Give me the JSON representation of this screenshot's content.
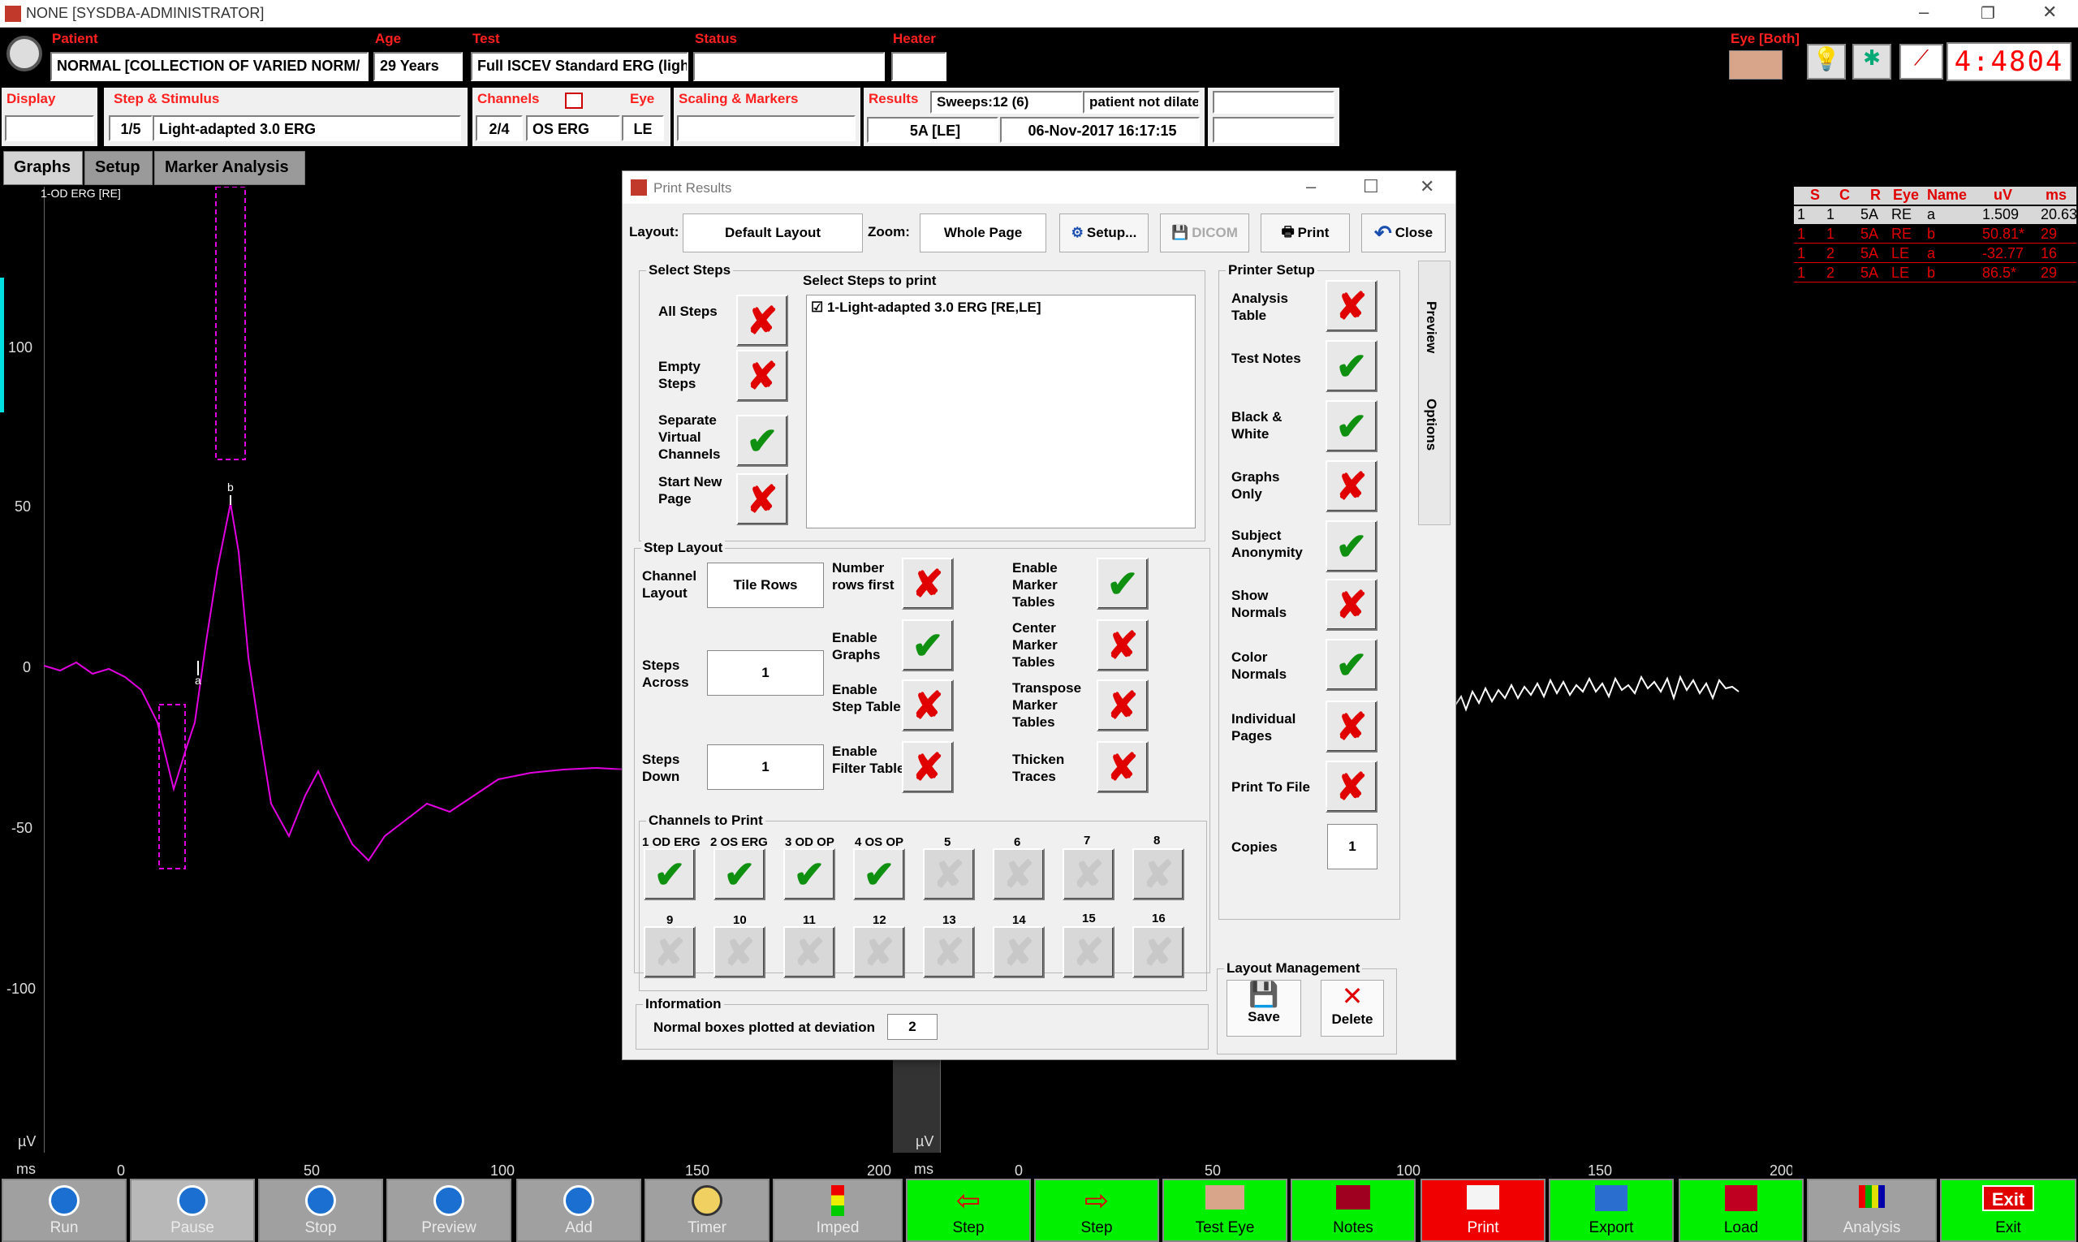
{
  "window": {
    "title": "NONE [SYSDBA-ADMINISTRATOR]"
  },
  "header": {
    "patient_label": "Patient",
    "patient_value": "NORMAL [COLLECTION OF VARIED NORM/",
    "age_label": "Age",
    "age_value": "29 Years",
    "test_label": "Test",
    "test_value": "Full ISCEV Standard ERG (ligh",
    "status_label": "Status",
    "heater_label": "Heater",
    "eye_label": "Eye [Both]",
    "timer": "4:4804",
    "display_label": "Display",
    "step_label": "Step & Stimulus",
    "step_num": "1/5",
    "step_value": "Light-adapted 3.0 ERG",
    "channels_label": "Channels",
    "channel_num": "2/4",
    "channel_value": "OS ERG",
    "eye_col_label": "Eye",
    "eye_value": "LE",
    "scaling_label": "Scaling & Markers",
    "results_label": "Results",
    "sweeps": "Sweeps:12 (6)",
    "results_note": "patient not dilate",
    "result_code": "5A [LE]",
    "result_date": "06-Nov-2017 16:17:15"
  },
  "tabs": [
    "Graphs",
    "Setup",
    "Marker Analysis"
  ],
  "graph_left": {
    "channel_label": "1-OD ERG [RE]",
    "y_ticks": [
      "100",
      "50",
      "0",
      "-50",
      "-100"
    ],
    "x_ticks": [
      "0",
      "50",
      "100",
      "150",
      "200"
    ],
    "unit_y": "µV",
    "unit_x": "ms",
    "marker_a": "a",
    "marker_b": "b"
  },
  "graph_right": {
    "x_ticks": [
      "0",
      "50",
      "100",
      "150",
      "200"
    ],
    "unit_y": "µV",
    "unit_x": "ms"
  },
  "results_table": {
    "headers": [
      "S",
      "C",
      "R",
      "Eye",
      "Name",
      "uV",
      "ms"
    ],
    "rows": [
      [
        "1",
        "1",
        "5A",
        "RE",
        "a",
        "1.509",
        "20.63"
      ],
      [
        "1",
        "1",
        "5A",
        "RE",
        "b",
        "50.81*",
        "29"
      ],
      [
        "1",
        "2",
        "5A",
        "LE",
        "a",
        "-32.77",
        "16"
      ],
      [
        "1",
        "2",
        "5A",
        "LE",
        "b",
        "86.5*",
        "29"
      ]
    ]
  },
  "toolbar": [
    "Run",
    "Pause",
    "Stop",
    "Preview",
    "Add",
    "Timer",
    "Imped",
    "Step",
    "Step",
    "Test Eye",
    "Notes",
    "Print",
    "Export",
    "Load",
    "Analysis",
    "Exit"
  ],
  "exit_badge": "Exit",
  "dialog": {
    "title": "Print Results",
    "layout_label": "Layout:",
    "layout_value": "Default Layout",
    "zoom_label": "Zoom:",
    "zoom_value": "Whole Page",
    "setup_btn": "Setup...",
    "dicom_btn": "DICOM",
    "print_btn": "Print",
    "close_btn": "Close",
    "side_tabs": [
      "Preview",
      "Options"
    ],
    "select_steps_title": "Select Steps",
    "select_steps": [
      {
        "label": "All Steps",
        "state": "x"
      },
      {
        "label": "Empty Steps",
        "state": "x"
      },
      {
        "label": "Separate Virtual Channels",
        "state": "ok"
      },
      {
        "label": "Start New Page",
        "state": "x"
      }
    ],
    "steps_to_print_title": "Select Steps to print",
    "steps_to_print": [
      "1-Light-adapted 3.0 ERG [RE,LE]"
    ],
    "step_layout_title": "Step Layout",
    "channel_layout_label": "Channel Layout",
    "channel_layout_value": "Tile Rows",
    "steps_across_label": "Steps Across",
    "steps_across_value": "1",
    "steps_down_label": "Steps Down",
    "steps_down_value": "1",
    "layout_opts_a": [
      {
        "label": "Number rows first",
        "state": "x"
      },
      {
        "label": "Enable Graphs",
        "state": "ok"
      },
      {
        "label": "Enable Step Table",
        "state": "x"
      },
      {
        "label": "Enable Filter Table",
        "state": "x"
      }
    ],
    "layout_opts_b": [
      {
        "label": "Enable Marker Tables",
        "state": "ok"
      },
      {
        "label": "Center Marker Tables",
        "state": "x"
      },
      {
        "label": "Transpose Marker Tables",
        "state": "x"
      },
      {
        "label": "Thicken Traces",
        "state": "x"
      }
    ],
    "channels_title": "Channels to Print",
    "channels": [
      {
        "label": "1 OD ERG",
        "state": "ok"
      },
      {
        "label": "2 OS ERG",
        "state": "ok"
      },
      {
        "label": "3 OD OP",
        "state": "ok"
      },
      {
        "label": "4 OS OP",
        "state": "ok"
      },
      {
        "label": "5",
        "state": "dis"
      },
      {
        "label": "6",
        "state": "dis"
      },
      {
        "label": "7",
        "state": "dis"
      },
      {
        "label": "8",
        "state": "dis"
      },
      {
        "label": "9",
        "state": "dis"
      },
      {
        "label": "10",
        "state": "dis"
      },
      {
        "label": "11",
        "state": "dis"
      },
      {
        "label": "12",
        "state": "dis"
      },
      {
        "label": "13",
        "state": "dis"
      },
      {
        "label": "14",
        "state": "dis"
      },
      {
        "label": "15",
        "state": "dis"
      },
      {
        "label": "16",
        "state": "dis"
      }
    ],
    "info_title": "Information",
    "info_label": "Normal boxes plotted at deviation",
    "info_value": "2",
    "printer_setup_title": "Printer Setup",
    "printer_opts": [
      {
        "label": "Analysis Table",
        "state": "x"
      },
      {
        "label": "Test Notes",
        "state": "ok"
      },
      {
        "label": "Black & White",
        "state": "ok"
      },
      {
        "label": "Graphs Only",
        "state": "x"
      },
      {
        "label": "Subject Anonymity",
        "state": "ok"
      },
      {
        "label": "Show Normals",
        "state": "x"
      },
      {
        "label": "Color Normals",
        "state": "ok"
      },
      {
        "label": "Individual Pages",
        "state": "x"
      },
      {
        "label": "Print To File",
        "state": "x"
      }
    ],
    "copies_label": "Copies",
    "copies_value": "1",
    "layout_mgmt_title": "Layout Management",
    "save_btn": "Save",
    "delete_btn": "Delete"
  }
}
